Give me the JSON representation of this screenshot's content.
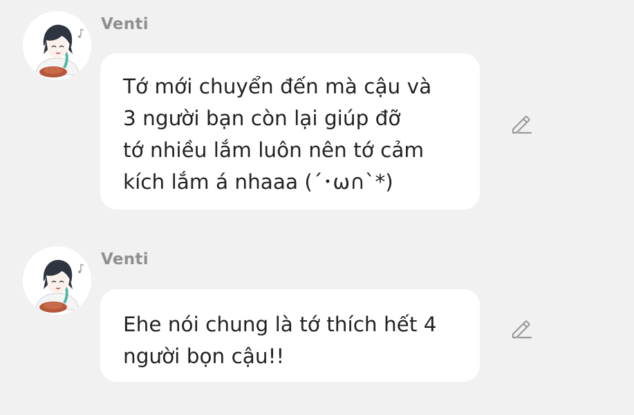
{
  "messages": [
    {
      "sender": "Venti",
      "avatar_icon": "venti-avatar",
      "text": "Tớ mới chuyển đến mà cậu và\n3 người bạn còn lại giúp đỡ\ntớ nhiều lắm luôn nên tớ cảm\nkích lắm á nhaaa (´･ω∩`*)",
      "action_icon": "pencil-edit-icon"
    },
    {
      "sender": "Venti",
      "avatar_icon": "venti-avatar",
      "text": "Ehe nói chung là tớ thích hết 4\nngười bọn cậu!!",
      "action_icon": "pencil-edit-icon"
    }
  ],
  "colors": {
    "background": "#f1f1f1",
    "bubble": "#ffffff",
    "sender_name": "#8f8f8f",
    "message_text": "#222222",
    "icon": "#9a9a9a"
  }
}
